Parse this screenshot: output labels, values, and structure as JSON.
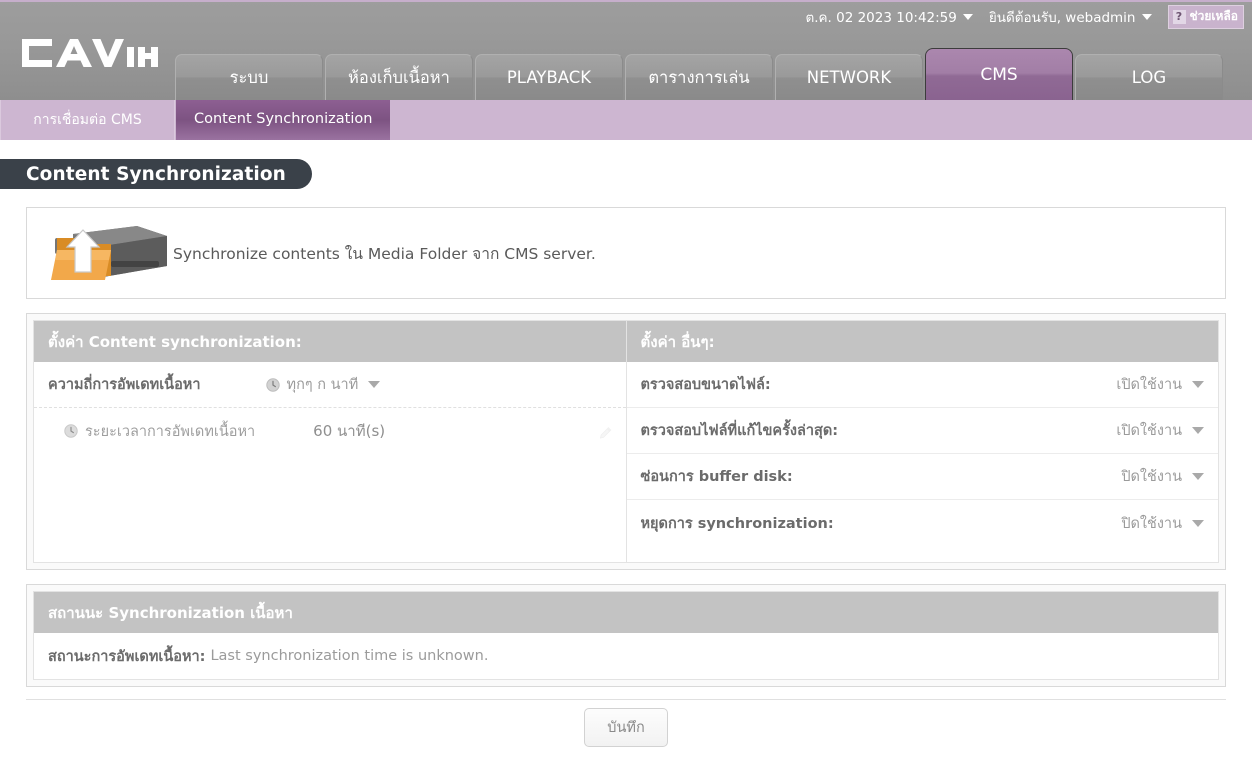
{
  "header": {
    "logo_text": "CAVIN",
    "datetime": "ต.ค. 02 2023 10:42:59",
    "welcome": "ยินดีต้อนรับ, webadmin",
    "help_label": "ช่วยเหลือ",
    "help_glyph": "?",
    "tabs": [
      {
        "label": "ระบบ",
        "active": false
      },
      {
        "label": "ห้องเก็บเนื้อหา",
        "active": false
      },
      {
        "label": "PLAYBACK",
        "active": false
      },
      {
        "label": "ตารางการเล่น",
        "active": false
      },
      {
        "label": "NETWORK",
        "active": false
      },
      {
        "label": "CMS",
        "active": true
      },
      {
        "label": "LOG",
        "active": false
      }
    ],
    "subtabs": [
      {
        "label": "การเชื่อมต่อ CMS",
        "active": false
      },
      {
        "label": "Content Synchronization",
        "active": true
      }
    ]
  },
  "page": {
    "title": "Content Synchronization",
    "banner_text": "Synchronize contents ใน Media Folder จาก CMS server."
  },
  "settings": {
    "left": {
      "header": "ตั้งค่า Content synchronization:",
      "rows": [
        {
          "label": "ความถี่การอัพเดทเนื้อหา",
          "value": "ทุกๆ ก นาที",
          "type": "dropdown",
          "icon": "clock-icon"
        },
        {
          "label": "ระยะเวลาการอัพเดทเนื้อหา",
          "value": "60 นาที(s)",
          "type": "editable",
          "icon": "clock-icon"
        }
      ]
    },
    "right": {
      "header": "ตั้งค่า อื่นๆ:",
      "rows": [
        {
          "label": "ตรวจสอบขนาดไฟล์:",
          "value": "เปิดใช้งาน",
          "type": "dropdown"
        },
        {
          "label": "ตรวจสอบไฟล์ที่แก้ไขครั้งล่าสุด:",
          "value": "เปิดใช้งาน",
          "type": "dropdown"
        },
        {
          "label": "ซ่อนการ buffer disk:",
          "value": "ปิดใช้งาน",
          "type": "dropdown"
        },
        {
          "label": "หยุดการ synchronization:",
          "value": "ปิดใช้งาน",
          "type": "dropdown"
        }
      ]
    }
  },
  "status": {
    "header": "สถานนะ Synchronization เนื้อหา",
    "key": "สถานะการอัพเดทเนื้อหา:",
    "value": "Last synchronization time is unknown."
  },
  "footer": {
    "save_label": "บันทึก"
  },
  "colors": {
    "accent_purple": "#8d5f92",
    "tab_active": "#a27ea6",
    "subnav_bg": "#cdb6d1",
    "header_gray": "#989898",
    "title_bar": "#3a4149",
    "section_header": "#c3c3c3",
    "folder_orange": "#f0a340"
  }
}
